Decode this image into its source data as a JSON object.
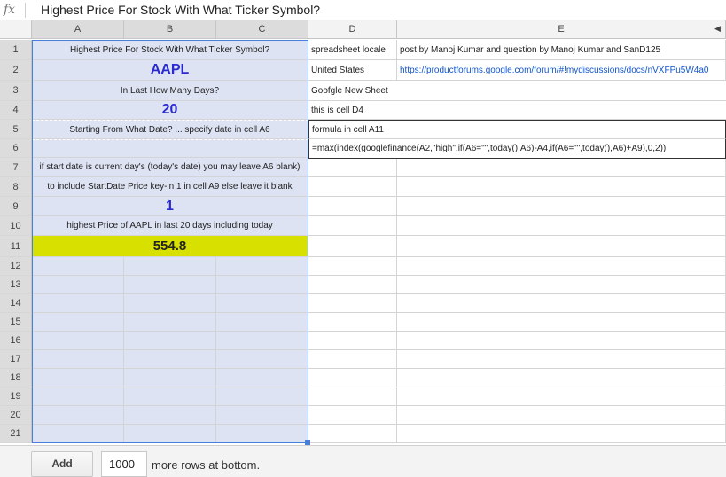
{
  "formula_bar": {
    "fx_label": "fx",
    "content": "Highest Price For Stock With What Ticker Symbol?"
  },
  "columns": [
    "A",
    "B",
    "C",
    "D",
    "E"
  ],
  "rows": [
    "1",
    "2",
    "3",
    "4",
    "5",
    "6",
    "7",
    "8",
    "9",
    "10",
    "11",
    "12",
    "13",
    "14",
    "15",
    "16",
    "17",
    "18",
    "19",
    "20",
    "21"
  ],
  "cells": {
    "A1": "Highest Price For Stock With What Ticker Symbol?",
    "A2": "AAPL",
    "A3": "In Last How Many Days?",
    "A4": "20",
    "A5": "Starting From What Date? ... specify date in cell A6",
    "A6": "",
    "A7": "if start date is current day's (today's date) you may leave A6 blank)",
    "A8": "to include StartDate Price key-in 1 in cell A9 else leave it blank",
    "A9": "1",
    "A10": "highest Price of AAPL in last 20 days including today",
    "A11": "554.8",
    "D1": "spreadsheet locale",
    "E1": "post by Manoj Kumar and question by Manoj Kumar and SanD125",
    "D2": "United States",
    "E2": "https://productforums.google.com/forum/#!mydiscussions/docs/nVXFPu5W4a0",
    "D3": "Goofgle New Sheet",
    "D4": "this is cell D4",
    "D5": "formula in cell A11",
    "D6": "=max(index(googlefinance(A2,\"high\",if(A6=\"\",today(),A6)-A4,if(A6=\"\",today(),A6)+A9),0,2))"
  },
  "bottom_bar": {
    "add_label": "Add",
    "rows_value": "1000",
    "more_rows_label": "more rows at bottom."
  },
  "colors": {
    "selection": "#dde3f3",
    "highlight": "#d8e000",
    "blue_text": "#2a2ad0"
  }
}
